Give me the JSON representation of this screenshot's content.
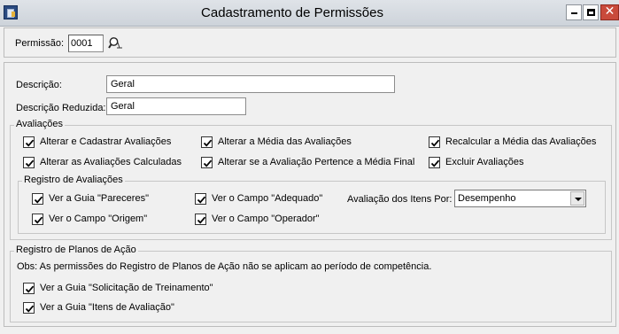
{
  "window": {
    "title": "Cadastramento de Permissões",
    "close_glyph": "✕"
  },
  "permissao": {
    "label": "Permissão:",
    "value": "0001",
    "search_icon": "search-icon"
  },
  "descricao": {
    "label": "Descrição:",
    "value": "Geral"
  },
  "descricao_reduzida": {
    "label": "Descrição Reduzida:",
    "value": "Geral"
  },
  "avaliacoes": {
    "title": "Avaliações",
    "checkboxes": [
      {
        "label": "Alterar e Cadastrar Avaliações",
        "checked": true
      },
      {
        "label": "Alterar a Média das Avaliações",
        "checked": true
      },
      {
        "label": "Recalcular a Média das Avaliações",
        "checked": true
      },
      {
        "label": "Alterar as Avaliações Calculadas",
        "checked": true
      },
      {
        "label": "Alterar se a Avaliação Pertence a Média Final",
        "checked": true
      },
      {
        "label": "Excluir Avaliações",
        "checked": true
      }
    ]
  },
  "registro_avaliacoes": {
    "title": "Registro de Avaliações",
    "checkboxes": [
      {
        "label": "Ver a Guia \"Pareceres\"",
        "checked": true
      },
      {
        "label": "Ver o Campo \"Adequado\"",
        "checked": true
      },
      {
        "label": "Ver o Campo \"Origem\"",
        "checked": true
      },
      {
        "label": "Ver o Campo \"Operador\"",
        "checked": true
      }
    ],
    "itens_por_label": "Avaliação dos Itens Por:",
    "itens_por_value": "Desempenho"
  },
  "planos_acao": {
    "title": "Registro de Planos de Ação",
    "note": "Obs: As permissões do Registro de Planos de Ação não se aplicam ao período de competência.",
    "checkboxes": [
      {
        "label": "Ver a Guia \"Solicitação de Treinamento\"",
        "checked": true
      },
      {
        "label": "Ver a Guia \"Itens de Avaliação\"",
        "checked": true
      }
    ]
  }
}
